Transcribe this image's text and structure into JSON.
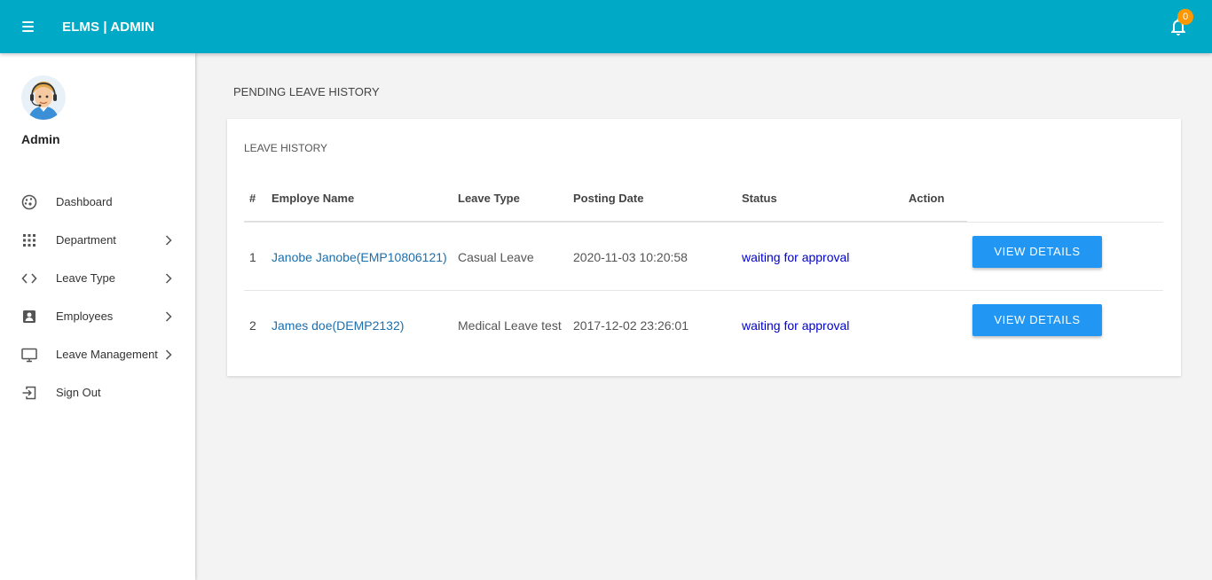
{
  "header": {
    "brand": "ELMS | ADMIN",
    "notification_count": "0",
    "bg_color": "#00a9c5"
  },
  "sidebar": {
    "user_name": "Admin",
    "items": [
      {
        "label": "Dashboard",
        "icon": "dashboard-icon",
        "has_submenu": false
      },
      {
        "label": "Department",
        "icon": "grid-icon",
        "has_submenu": true
      },
      {
        "label": "Leave Type",
        "icon": "code-icon",
        "has_submenu": true
      },
      {
        "label": "Employees",
        "icon": "account-box-icon",
        "has_submenu": true
      },
      {
        "label": "Leave Management",
        "icon": "desktop-icon",
        "has_submenu": true
      },
      {
        "label": "Sign Out",
        "icon": "sign-out-icon",
        "has_submenu": false
      }
    ]
  },
  "main": {
    "page_title": "PENDING LEAVE HISTORY",
    "card_title": "LEAVE HISTORY",
    "columns": [
      "#",
      "Employe Name",
      "Leave Type",
      "Posting Date",
      "Status",
      "Action"
    ],
    "rows": [
      {
        "num": "1",
        "name": "Janobe Janobe(EMP10806121)",
        "leave_type": "Casual Leave",
        "posting_date": "2020-11-03 10:20:58",
        "status": "waiting for approval",
        "action": "VIEW DETAILS"
      },
      {
        "num": "2",
        "name": "James doe(DEMP2132)",
        "leave_type": "Medical Leave test",
        "posting_date": "2017-12-02 23:26:01",
        "status": "waiting for approval",
        "action": "VIEW DETAILS"
      }
    ]
  },
  "colors": {
    "accent": "#2196f3",
    "badge": "#ff9800",
    "status": "#0000cc",
    "link": "#1a6fae"
  }
}
